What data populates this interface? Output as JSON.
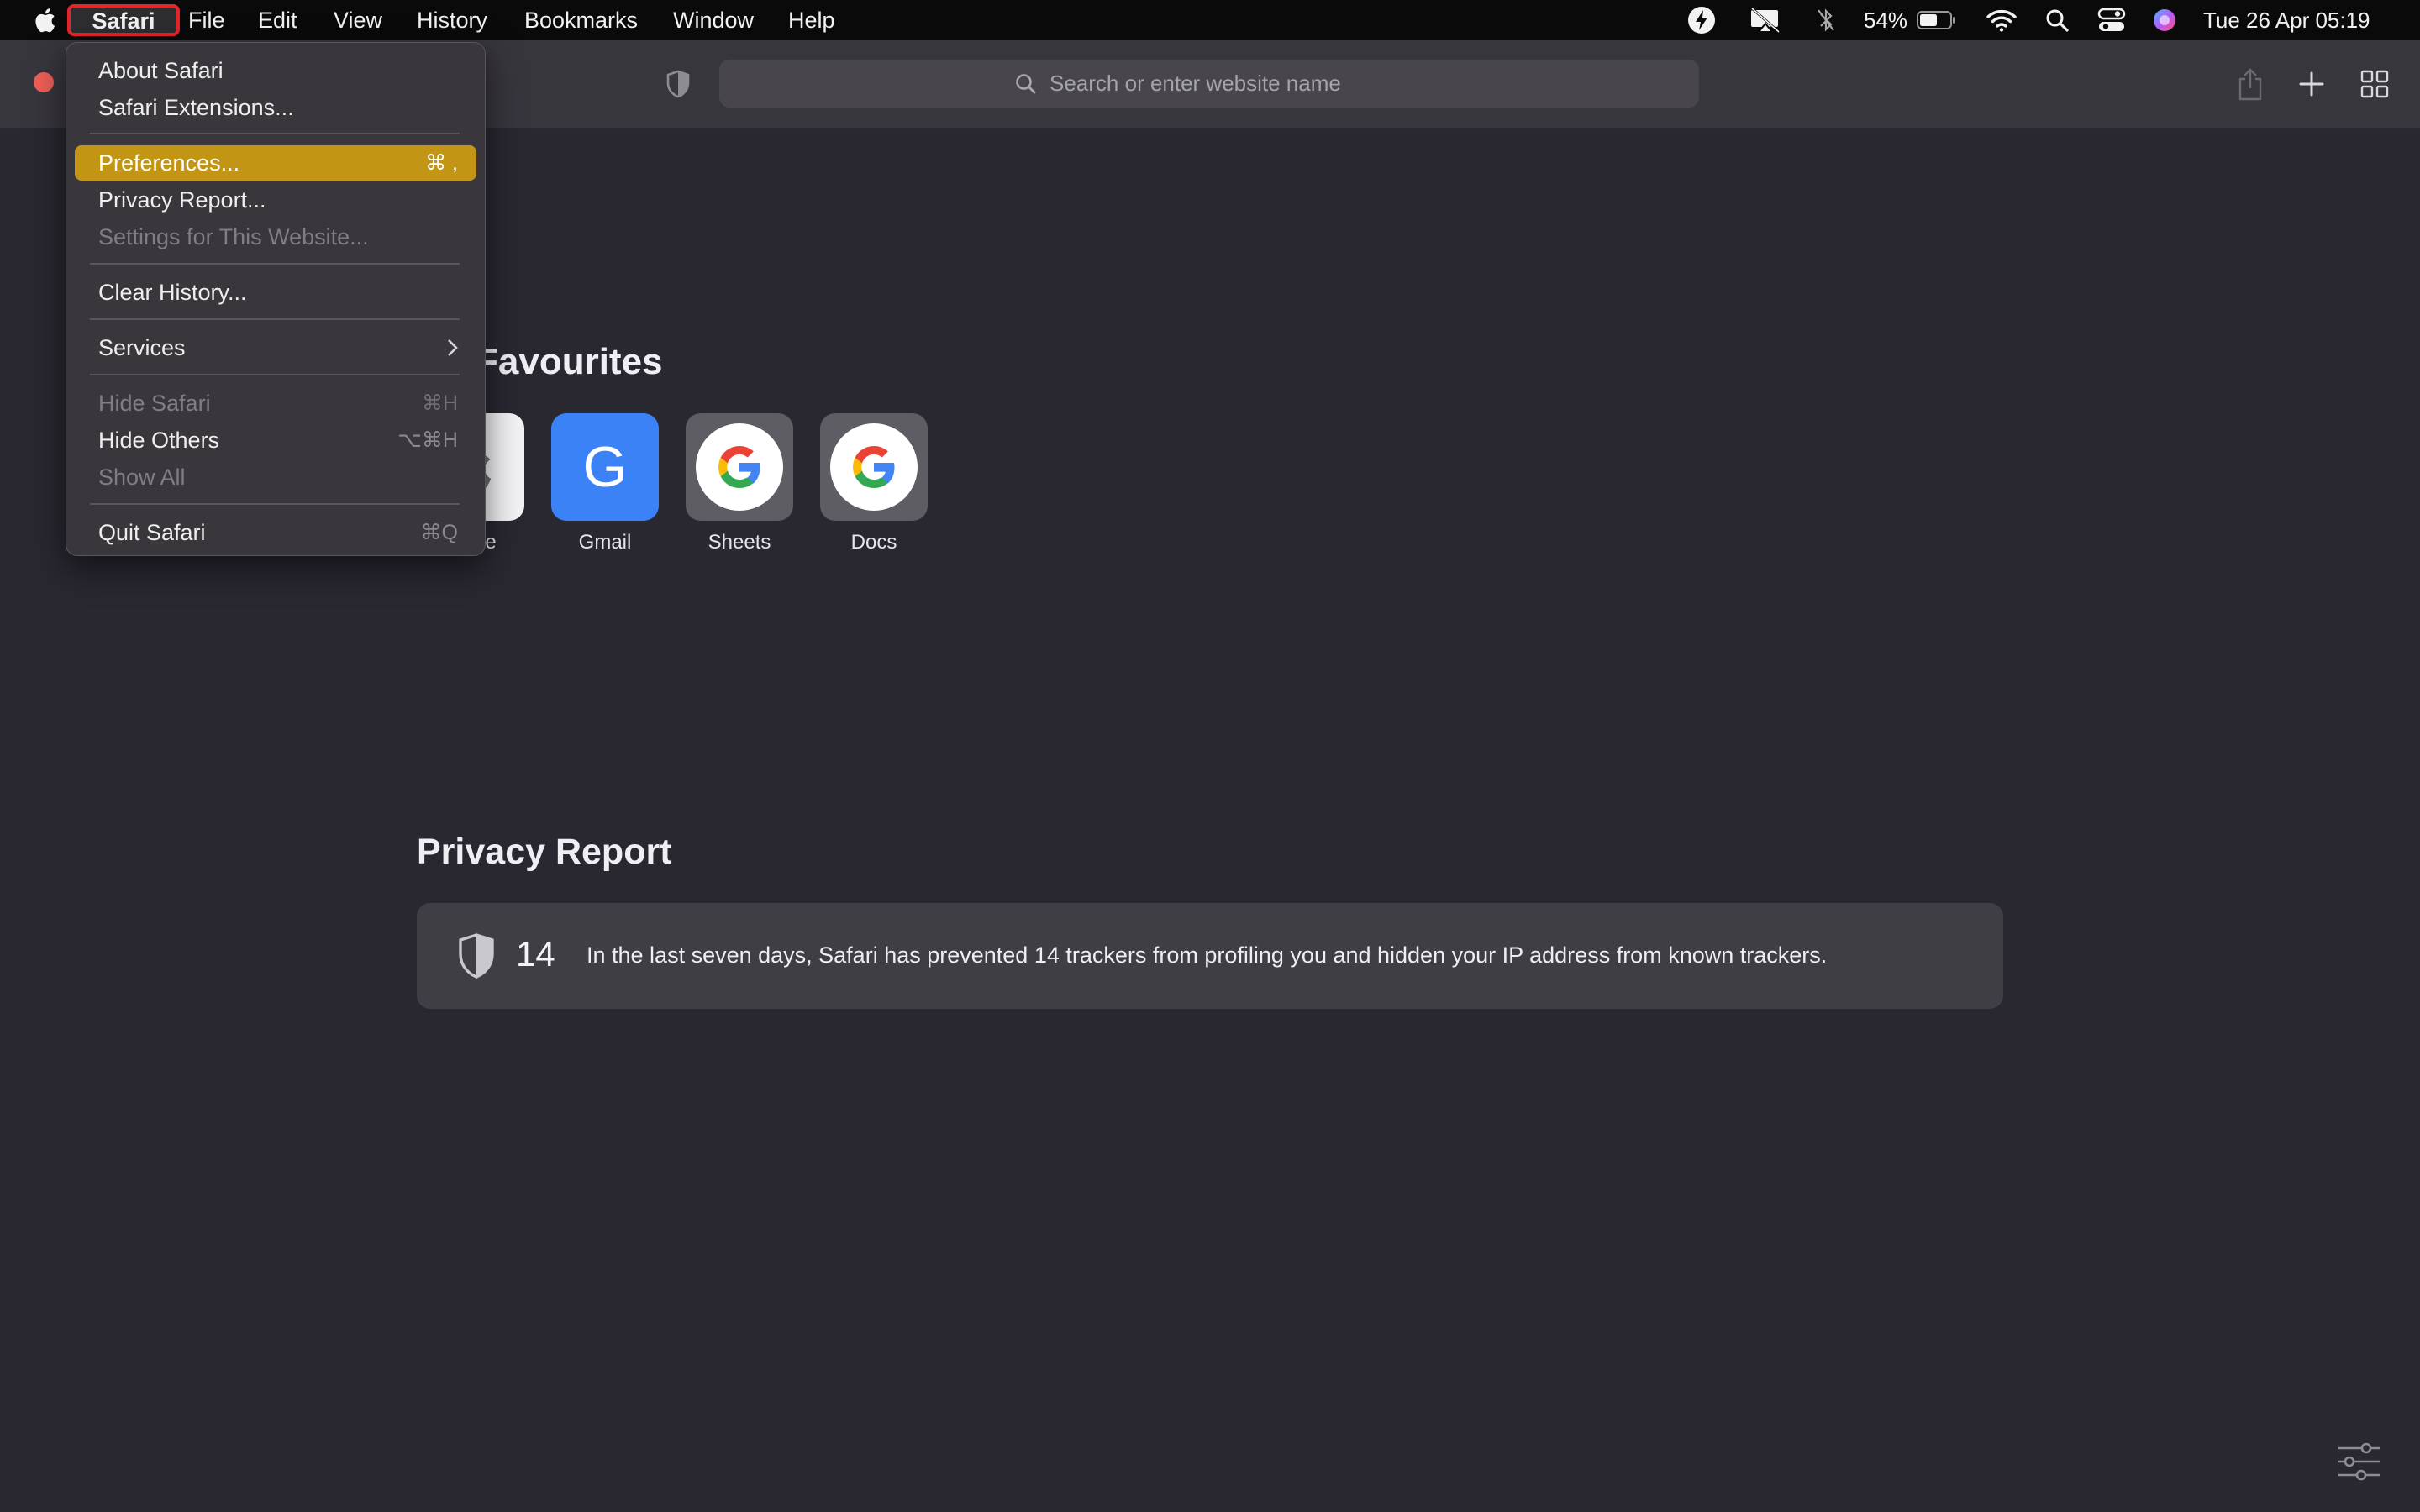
{
  "menubar": {
    "app_menu": "Safari",
    "items": [
      "File",
      "Edit",
      "View",
      "History",
      "Bookmarks",
      "Window",
      "Help"
    ],
    "status": {
      "battery_percent": "54%",
      "datetime": "Tue 26 Apr  05:19"
    }
  },
  "toolbar": {
    "search_placeholder": "Search or enter website name"
  },
  "favourites": {
    "title": "Favourites",
    "items": [
      {
        "label": "Apple"
      },
      {
        "label": "Gmail",
        "glyph": "G"
      },
      {
        "label": "Sheets"
      },
      {
        "label": "Docs"
      }
    ]
  },
  "privacy_report": {
    "title": "Privacy Report",
    "count": "14",
    "text": "In the last seven days, Safari has prevented 14 trackers from profiling you and hidden your IP address from known trackers."
  },
  "safari_menu": {
    "items": [
      {
        "label": "About Safari",
        "shortcut": ""
      },
      {
        "label": "Safari Extensions...",
        "shortcut": ""
      },
      {
        "label": "Preferences...",
        "shortcut": "⌘ ,"
      },
      {
        "label": "Privacy Report...",
        "shortcut": ""
      },
      {
        "label": "Settings for This Website...",
        "shortcut": ""
      },
      {
        "label": "Clear History...",
        "shortcut": ""
      },
      {
        "label": "Services",
        "shortcut": ""
      },
      {
        "label": "Hide Safari",
        "shortcut": "⌘H"
      },
      {
        "label": "Hide Others",
        "shortcut": "⌥⌘H"
      },
      {
        "label": "Show All",
        "shortcut": ""
      },
      {
        "label": "Quit Safari",
        "shortcut": "⌘Q"
      }
    ]
  },
  "colors": {
    "background": "#292730",
    "menu_highlight": "#c29515",
    "focus_ring": "#e3262b",
    "close_button": "#ec5f57",
    "gmail_tile": "#3b82f6"
  }
}
